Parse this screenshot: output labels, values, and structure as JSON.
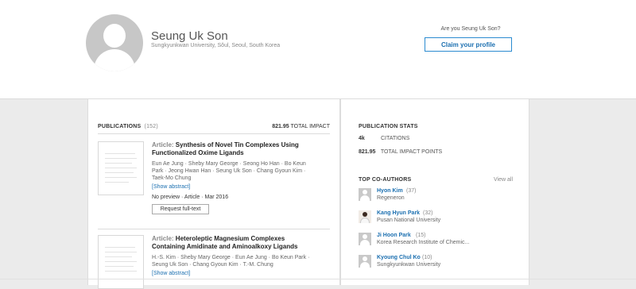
{
  "profile": {
    "name": "Seung Uk Son",
    "affiliation": "Sungkyunkwan University, Sŏul, Seoul, South Korea",
    "claim_prompt": "Are you Seung Uk Son?",
    "claim_button": "Claim your profile"
  },
  "publications": {
    "heading": "PUBLICATIONS",
    "count": "(152)",
    "impact_value": "821.95",
    "impact_label": "TOTAL IMPACT",
    "items": [
      {
        "kind": "Article:",
        "title": "Synthesis of Novel Tin Complexes Using Functionalized Oxime Ligands",
        "authors": "Eun Ae Jung · Sheby Mary George · Seong Ho Han · Bo Keun Park · Jeong Hwan Han · Seung Uk Son · Chang Gyoun Kim · Taek-Mo Chung",
        "show_abstract": "[Show abstract]",
        "meta": "No preview · Article · Mar 2016",
        "request_button": "Request full-text"
      },
      {
        "kind": "Article:",
        "title": "Heteroleptic Magnesium Complexes Containing Amidinate and Aminoalkoxy Ligands",
        "authors": "H.-S. Kim · Sheby Mary George · Eun Ae Jung · Bo Keun Park · Seung Uk Son · Chang Gyoun Kim · T.-M. Chung",
        "show_abstract": "[Show abstract]"
      }
    ]
  },
  "stats": {
    "heading": "PUBLICATION STATS",
    "citations_value": "4k",
    "citations_label": "CITATIONS",
    "impact_value": "821.95",
    "impact_label": "TOTAL IMPACT POINTS"
  },
  "coauthors": {
    "heading": "TOP CO-AUTHORS",
    "view_all": "View all",
    "items": [
      {
        "name": "Hyon Kim",
        "count": "(37)",
        "institution": "Regeneron",
        "avatar": "person-silhouette-icon"
      },
      {
        "name": "Kang Hyun Park",
        "count": "(32)",
        "institution": "Pusan National University",
        "avatar": "person-photo"
      },
      {
        "name": "Ji Hoon Park",
        "count": "(15)",
        "institution": "Korea Research Institute of Chemic...",
        "avatar": "person-silhouette-icon"
      },
      {
        "name": "Kyoung Chul Ko",
        "count": "(10)",
        "institution": "Sungkyunkwan University",
        "avatar": "person-silhouette-icon"
      }
    ]
  }
}
